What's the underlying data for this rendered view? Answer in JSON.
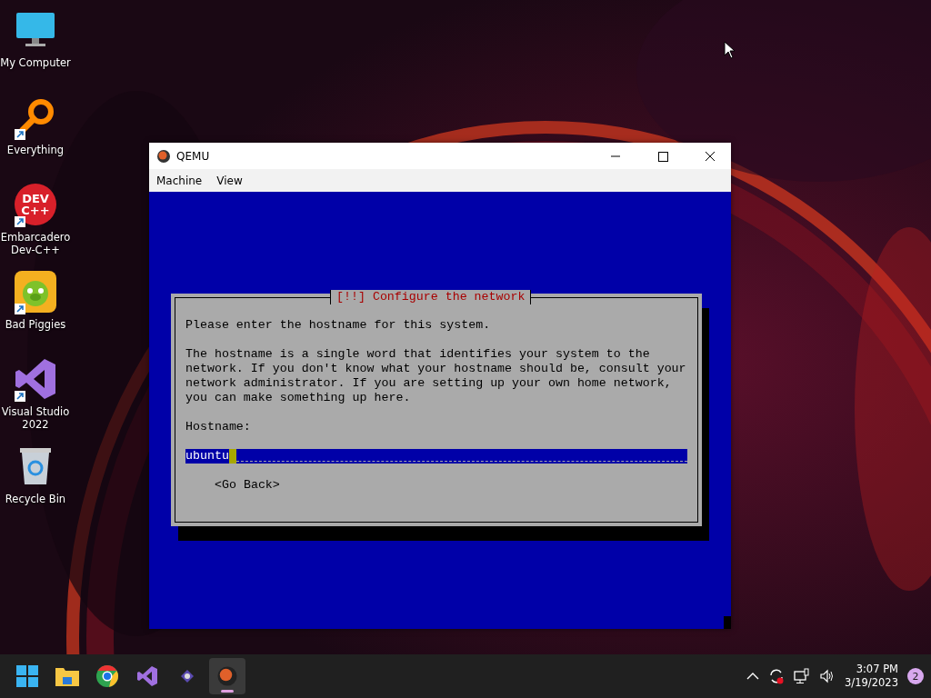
{
  "desktop_icons": [
    {
      "kind": "monitor",
      "label": "My Computer",
      "shortcut": false
    },
    {
      "kind": "search",
      "label": "Everything",
      "shortcut": true
    },
    {
      "kind": "devcpp",
      "label": "Embarcadero Dev-C++",
      "shortcut": true,
      "logo_text": [
        "DEV",
        "C++"
      ]
    },
    {
      "kind": "game",
      "label": "Bad Piggies",
      "shortcut": true
    },
    {
      "kind": "vs",
      "label": "Visual Studio 2022",
      "shortcut": true
    },
    {
      "kind": "bin",
      "label": "Recycle Bin",
      "shortcut": false
    }
  ],
  "window": {
    "title": "QEMU",
    "menu": [
      "Machine",
      "View"
    ],
    "dialog": {
      "title": "[!!] Configure the network",
      "prompt": "Please enter the hostname for this system.",
      "description": "The hostname is a single word that identifies your system to the network. If you don't know what your hostname should be, consult your network administrator. If you are setting up your own home network, you can make something up here.",
      "field_label": "Hostname:",
      "field_value": "ubuntu",
      "button": "<Go Back>"
    }
  },
  "taskbar": {
    "apps": [
      {
        "kind": "start",
        "selected": false
      },
      {
        "kind": "folder",
        "selected": false
      },
      {
        "kind": "chrome",
        "selected": false
      },
      {
        "kind": "vs",
        "selected": false
      },
      {
        "kind": "small",
        "selected": false
      },
      {
        "kind": "qemu",
        "selected": true
      }
    ],
    "time": "3:07 PM",
    "date": "3/19/2023",
    "notifications": "2"
  }
}
